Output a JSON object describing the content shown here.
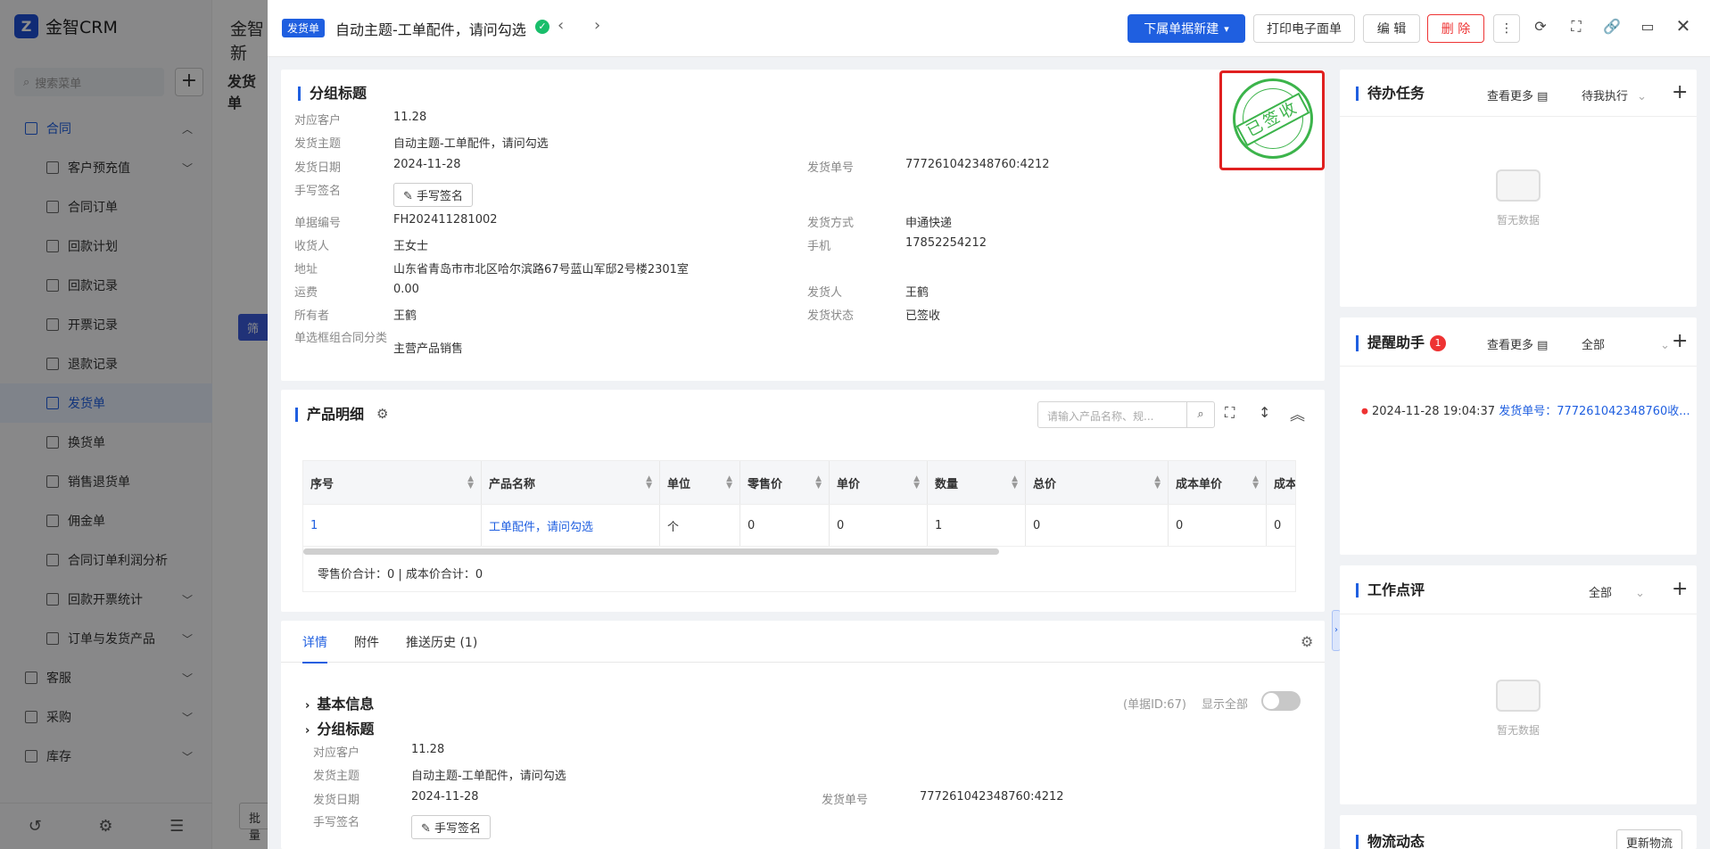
{
  "app": {
    "logo": "金智CRM",
    "search_placeholder": "搜索菜单",
    "title_partial": "金智新",
    "tab_partial": "发货单",
    "filter_btn": "筛",
    "bottom_partial": "批量",
    "menu": [
      {
        "label": "合同",
        "level": 0,
        "state": "parent"
      },
      {
        "label": "客户预充值",
        "level": 1,
        "chev": true
      },
      {
        "label": "合同订单",
        "level": 1
      },
      {
        "label": "回款计划",
        "level": 1
      },
      {
        "label": "回款记录",
        "level": 1
      },
      {
        "label": "开票记录",
        "level": 1
      },
      {
        "label": "退款记录",
        "level": 1
      },
      {
        "label": "发货单",
        "level": 1,
        "state": "active"
      },
      {
        "label": "换货单",
        "level": 1
      },
      {
        "label": "销售退货单",
        "level": 1
      },
      {
        "label": "佣金单",
        "level": 1
      },
      {
        "label": "合同订单利润分析",
        "level": 1
      },
      {
        "label": "回款开票统计",
        "level": 1,
        "chev": true
      },
      {
        "label": "订单与发货产品",
        "level": 1,
        "chev": true
      },
      {
        "label": "客服",
        "level": 0,
        "chev": true
      },
      {
        "label": "采购",
        "level": 0,
        "chev": true
      },
      {
        "label": "库存",
        "level": 0,
        "chev": true
      }
    ]
  },
  "drawer": {
    "tag": "发货单",
    "title": "自动主题-工单配件，请问勾选",
    "buttons": {
      "new_sub": "下属单据新建",
      "print": "打印电子面单",
      "edit": "编 辑",
      "delete": "删 除"
    },
    "group": {
      "title": "分组标题",
      "fields_left": [
        {
          "label": "对应客户",
          "value": "11.28",
          "link": true
        },
        {
          "label": "发货主题",
          "value": "自动主题-工单配件，请问勾选"
        },
        {
          "label": "发货日期",
          "value": "2024-11-28"
        },
        {
          "label": "手写签名",
          "value": ""
        },
        {
          "label": "单据编号",
          "value": "FH202411281002"
        },
        {
          "label": "收货人",
          "value": "王女士"
        },
        {
          "label": "地址",
          "value": "山东省青岛市市北区哈尔滨路67号蓝山军邸2号楼2301室"
        },
        {
          "label": "运费",
          "value": "0.00"
        },
        {
          "label": "所有者",
          "value": "王鹤"
        },
        {
          "label": "单选框组合同分类",
          "value": "主营产品销售"
        }
      ],
      "fields_right": [
        {
          "label": "发货单号",
          "value": "777261042348760:4212"
        },
        {
          "label": "发货方式",
          "value": "申通快递"
        },
        {
          "label": "手机",
          "value": "17852254212"
        },
        {
          "label": "发货人",
          "value": "王鹤"
        },
        {
          "label": "发货状态",
          "value": "已签收"
        }
      ],
      "sign_btn": "手写签名",
      "stamp_text": "已签收"
    },
    "products": {
      "title": "产品明细",
      "search_placeholder": "请输入产品名称、规...",
      "columns": [
        "序号",
        "产品名称",
        "单位",
        "零售价",
        "单价",
        "数量",
        "总价",
        "成本单价",
        "成本小"
      ],
      "rows": [
        [
          "1",
          "工单配件，请问勾选",
          "个",
          "0",
          "0",
          "1",
          "0",
          "0",
          "0"
        ]
      ],
      "summary": "零售价合计：0 |   成本价合计：0"
    },
    "tabs": [
      "详情",
      "附件",
      "推送历史 (1)"
    ],
    "detail": {
      "basic_info": "基本信息",
      "group_title": "分组标题",
      "doc_id": "(单据ID:67)",
      "show_all": "显示全部",
      "fields_left": [
        {
          "label": "对应客户",
          "value": "11.28",
          "link": true
        },
        {
          "label": "发货主题",
          "value": "自动主题-工单配件，请问勾选"
        },
        {
          "label": "发货日期",
          "value": "2024-11-28"
        },
        {
          "label": "手写签名",
          "value": ""
        }
      ],
      "fields_right": [
        {
          "label": "发货单号",
          "value": "777261042348760:4212"
        }
      ],
      "sign_btn": "手写签名"
    }
  },
  "right": {
    "todo": {
      "title": "待办任务",
      "more": "查看更多",
      "filter": "待我执行",
      "empty": "暂无数据"
    },
    "reminder": {
      "title": "提醒助手",
      "badge": "1",
      "more": "查看更多",
      "filter": "全部",
      "item_time": "2024-11-28 19:04:37",
      "item_link": "发货单号：777261042348760收..."
    },
    "review": {
      "title": "工作点评",
      "filter": "全部",
      "empty": "暂无数据"
    },
    "logistics": {
      "title": "物流动态",
      "refresh": "更新物流"
    }
  }
}
